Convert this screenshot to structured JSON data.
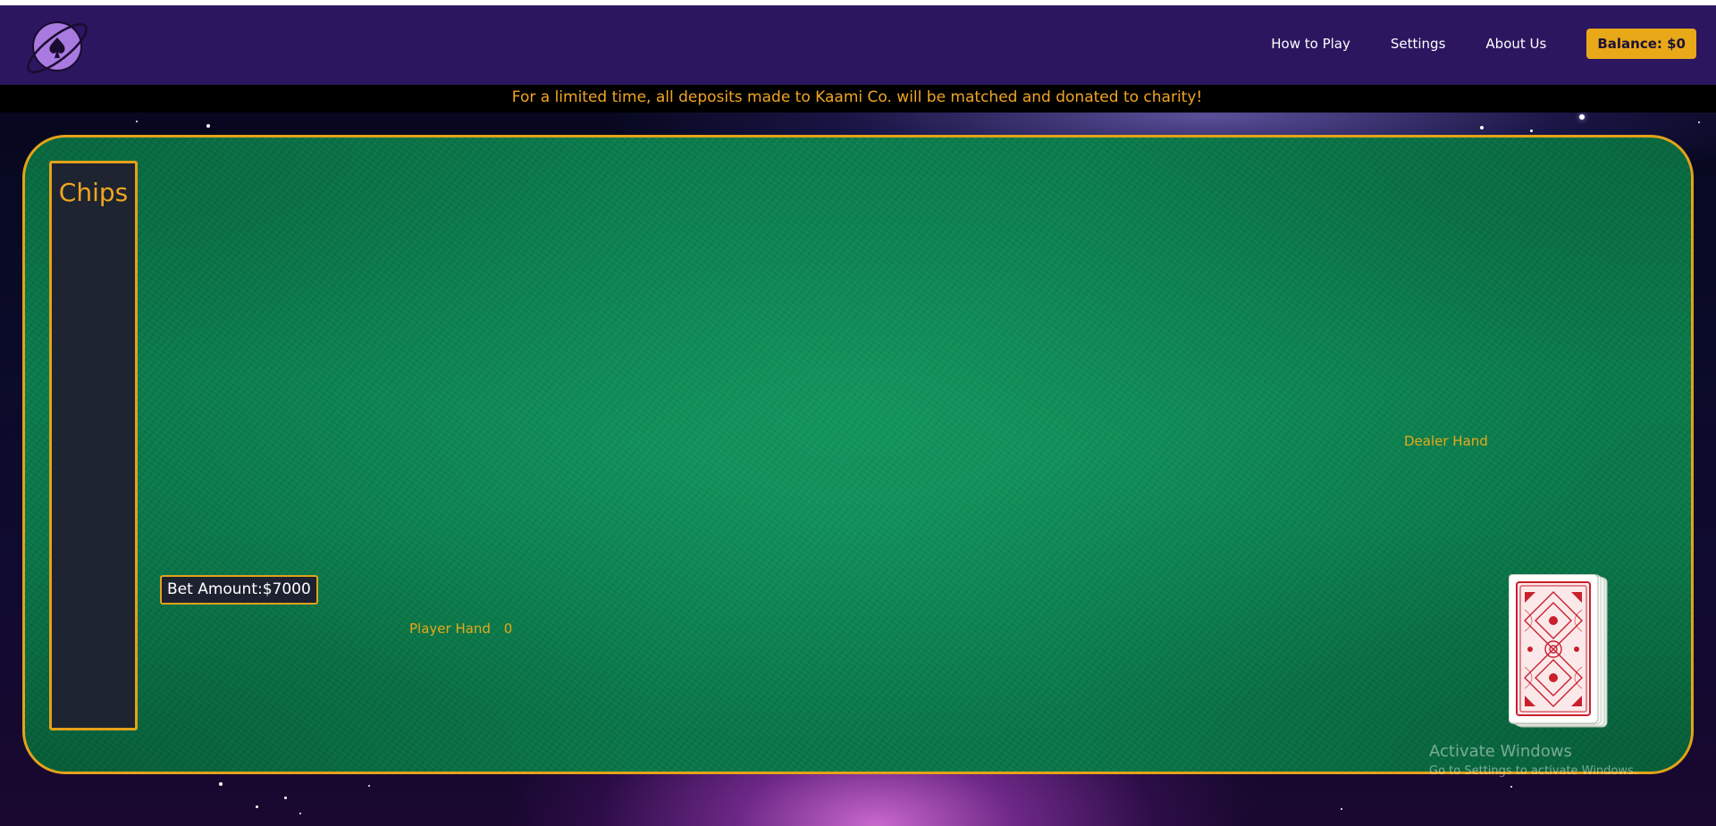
{
  "header": {
    "logo_icon": "planet-spade-logo-icon",
    "nav": [
      {
        "label": "How to Play"
      },
      {
        "label": "Settings"
      },
      {
        "label": "About Us"
      }
    ],
    "balance_label": "Balance: $0"
  },
  "banner": {
    "text": "For a limited time, all deposits made to Kaami Co. will be matched and donated to charity!"
  },
  "table": {
    "chips_title": "Chips",
    "bet_amount": "Bet Amount:$7000",
    "player_hand_label": "Player Hand",
    "player_hand_score": "0",
    "dealer_hand_label": "Dealer Hand",
    "deck_icon": "card-deck-back-icon"
  },
  "os_watermark": {
    "title": "Activate Windows",
    "subtitle": "Go to Settings to activate Windows."
  },
  "colors": {
    "header_bg": "#2c1660",
    "accent_gold": "#e9a818",
    "felt_green": "#0a8a55",
    "panel_dark": "#1e2430",
    "card_red": "#c9202c"
  }
}
